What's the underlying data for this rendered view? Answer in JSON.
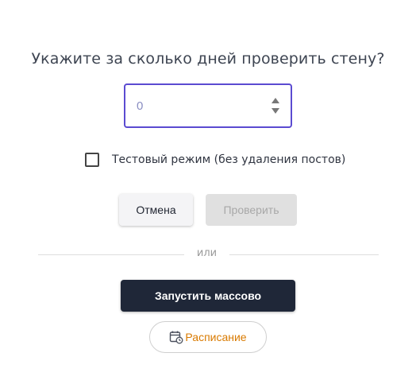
{
  "dialog": {
    "title": "Укажите за сколько дней проверить стену?",
    "days_input": {
      "value": "",
      "placeholder": "0"
    },
    "test_mode": {
      "checked": false,
      "label": "Тестовый режим (без удаления постов)"
    },
    "cancel_label": "Отмена",
    "check_label": "Проверить",
    "or_label": "или",
    "mass_run_label": "Запустить массово",
    "schedule_label": "Расписание",
    "icons": {
      "schedule": "calendar-clock-icon",
      "spinner_up": "caret-up-icon",
      "spinner_down": "caret-down-icon"
    },
    "colors": {
      "focus_border": "#5b4bd1",
      "primary_dark": "#1f2738",
      "schedule_accent": "#d97a00",
      "disabled_bg": "#e0e0e0"
    }
  }
}
